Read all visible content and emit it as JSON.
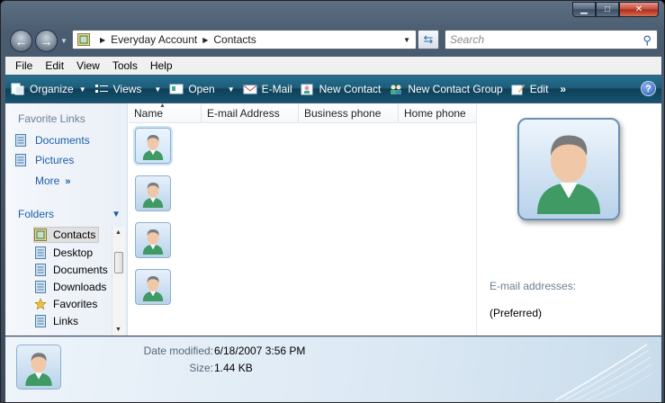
{
  "address": {
    "crumbs": [
      "Everyday Account",
      "Contacts"
    ]
  },
  "search": {
    "placeholder": "Search"
  },
  "menu": [
    "File",
    "Edit",
    "View",
    "Tools",
    "Help"
  ],
  "toolbar": {
    "organize": "Organize",
    "views": "Views",
    "open": "Open",
    "email": "E-Mail",
    "new_contact": "New Contact",
    "new_contact_group": "New Contact Group",
    "edit": "Edit",
    "overflow": "»",
    "help": "?"
  },
  "nav": {
    "favorites_title": "Favorite Links",
    "favorites": [
      "Documents",
      "Pictures"
    ],
    "more": "More",
    "folders_title": "Folders",
    "tree": [
      "Contacts",
      "Desktop",
      "Documents",
      "Downloads",
      "Favorites",
      "Links"
    ]
  },
  "columns": [
    "Name",
    "E-mail Address",
    "Business phone",
    "Home phone"
  ],
  "preview": {
    "email_label": "E-mail addresses:",
    "preferred": "(Preferred)"
  },
  "details": {
    "date_label": "Date modified:",
    "date_value": "6/18/2007 3:56 PM",
    "size_label": "Size:",
    "size_value": "1.44 KB"
  },
  "colors": {
    "command_bar": "#1e5d7a",
    "link": "#1c5eaa",
    "frame": "#4a5c70"
  }
}
